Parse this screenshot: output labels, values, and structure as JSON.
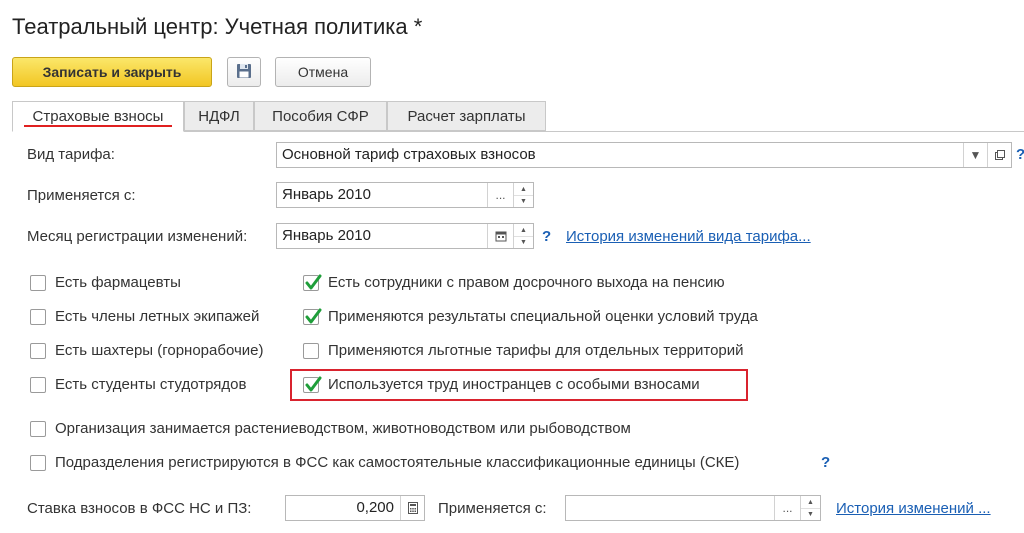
{
  "window": {
    "title": "Театральный центр: Учетная политика *"
  },
  "toolbar": {
    "save_close_label": "Записать и закрыть",
    "save_icon": "floppy-disk-icon",
    "cancel_label": "Отмена"
  },
  "tabs": [
    {
      "label": "Страховые взносы",
      "active": true
    },
    {
      "label": "НДФЛ",
      "active": false
    },
    {
      "label": "Пособия СФР",
      "active": false
    },
    {
      "label": "Расчет зарплаты",
      "active": false
    }
  ],
  "form": {
    "tariff_type": {
      "label": "Вид тарифа:",
      "value": "Основной тариф страховых взносов",
      "help": "?"
    },
    "applies_from": {
      "label": "Применяется с:",
      "value": "Январь 2010"
    },
    "reg_month": {
      "label": "Месяц регистрации изменений:",
      "value": "Январь 2010",
      "help": "?",
      "history_link": "История изменений вида тарифа..."
    },
    "checkboxes_left": [
      {
        "label": "Есть фармацевты",
        "checked": false
      },
      {
        "label": "Есть члены летных экипажей",
        "checked": false
      },
      {
        "label": "Есть шахтеры (горнорабочие)",
        "checked": false
      },
      {
        "label": "Есть студенты студотрядов",
        "checked": false
      }
    ],
    "checkboxes_right": [
      {
        "label": "Есть сотрудники с правом досрочного выхода на пенсию",
        "checked": true
      },
      {
        "label": "Применяются результаты специальной оценки условий труда",
        "checked": true
      },
      {
        "label": "Применяются льготные тарифы для отдельных территорий",
        "checked": false
      },
      {
        "label": "Используется труд иностранцев с особыми взносами",
        "checked": true
      }
    ],
    "agro": {
      "label": "Организация занимается растениеводством, животноводством или рыбоводством",
      "checked": false
    },
    "fss_units": {
      "label": "Подразделения регистрируются в ФСС как самостоятельные классификационные единицы (СКЕ)",
      "checked": false,
      "help": "?"
    },
    "fss_rate": {
      "label": "Ставка взносов в ФСС НС и ПЗ:",
      "value": "0,200",
      "applies_label": "Применяется с:",
      "applies_value": "",
      "history_link": "История изменений ..."
    }
  },
  "colors": {
    "accent_yellow": "#f2c623",
    "link_blue": "#1a5fb4",
    "check_green": "#1f9e3a",
    "highlight_red": "#d9232e"
  }
}
